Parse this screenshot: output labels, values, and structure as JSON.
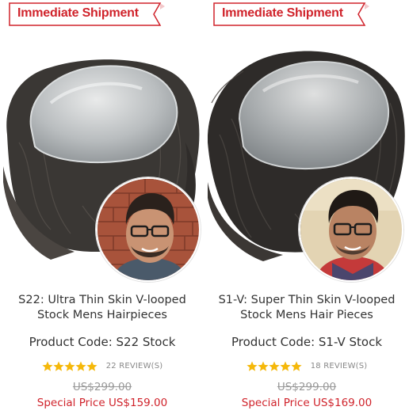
{
  "colors": {
    "ribbon_red": "#d0232b",
    "star_gold": "#f5b80a",
    "price_red": "#d0232b"
  },
  "products": [
    {
      "badge": "Immediate Shipment",
      "title_line1": "S22: Ultra Thin Skin V-looped",
      "title_line2": "Stock Mens Hairpieces",
      "product_code": "Product Code: S22 Stock",
      "rating": 5,
      "reviews": "22 REVIEW(S)",
      "old_price": "US$299.00",
      "special_label": "Special Price",
      "special_price": "US$159.00",
      "image": "skin-hairpiece-photo",
      "avatar_background": "brick-wall"
    },
    {
      "badge": "Immediate Shipment",
      "title_line1": "S1-V: Super Thin Skin V-looped",
      "title_line2": "Stock Mens Hair Pieces",
      "product_code": "Product Code: S1-V Stock",
      "rating": 5,
      "reviews": "18 REVIEW(S)",
      "old_price": "US$299.00",
      "special_label": "Special Price",
      "special_price": "US$169.00",
      "image": "skin-hairpiece-photo",
      "avatar_background": "beige-wall"
    }
  ]
}
